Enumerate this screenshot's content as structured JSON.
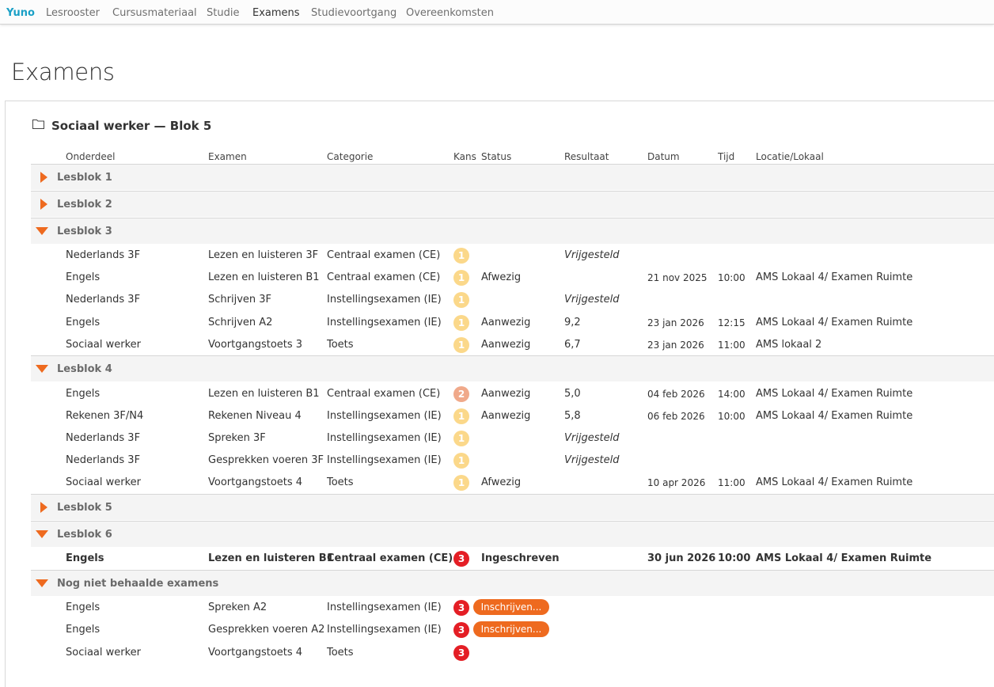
{
  "nav": {
    "brand": "Yuno",
    "items": [
      "Lesrooster",
      "Cursusmateriaal",
      "Studie",
      "Examens",
      "Studievoortgang",
      "Overeenkomsten"
    ],
    "active": "Examens"
  },
  "page": {
    "title": "Examens"
  },
  "panel": {
    "title": "Sociaal werker — Blok 5",
    "icon": "folder-icon"
  },
  "columns": {
    "onderdeel": "Onderdeel",
    "examen": "Examen",
    "categorie": "Categorie",
    "kans": "Kans",
    "status": "Status",
    "resultaat": "Resultaat",
    "datum": "Datum",
    "tijd": "Tijd",
    "locatie": "Locatie/Lokaal"
  },
  "colors": {
    "accent": "#ee6a1f",
    "brand": "#1aa0c6",
    "kans1": "#fbd88a",
    "kans2": "#f0a98a",
    "kans3": "#e41e25"
  },
  "groups": [
    {
      "label": "Lesblok 1",
      "expanded": false
    },
    {
      "label": "Lesblok 2",
      "expanded": false
    },
    {
      "label": "Lesblok 3",
      "expanded": true
    },
    {
      "label": "Lesblok 4",
      "expanded": true
    },
    {
      "label": "Lesblok 5",
      "expanded": false
    },
    {
      "label": "Lesblok 6",
      "expanded": true
    },
    {
      "label": "Nog niet behaalde examens",
      "expanded": true
    }
  ],
  "lesblok3": [
    {
      "onderdeel": "Nederlands 3F",
      "examen": "Lezen en luisteren 3F",
      "categorie": "Centraal examen (CE)",
      "kans": "1",
      "status": "",
      "resultaat": "Vrijgesteld",
      "datum": "",
      "tijd": "",
      "locatie": ""
    },
    {
      "onderdeel": "Engels",
      "examen": "Lezen en luisteren B1",
      "categorie": "Centraal examen (CE)",
      "kans": "1",
      "status": "Afwezig",
      "resultaat": "",
      "datum": "21 nov 2025",
      "tijd": "10:00",
      "locatie": "AMS Lokaal 4/ Examen Ruimte"
    },
    {
      "onderdeel": "Nederlands 3F",
      "examen": "Schrijven 3F",
      "categorie": "Instellingsexamen (IE)",
      "kans": "1",
      "status": "",
      "resultaat": "Vrijgesteld",
      "datum": "",
      "tijd": "",
      "locatie": ""
    },
    {
      "onderdeel": "Engels",
      "examen": "Schrijven A2",
      "categorie": "Instellingsexamen (IE)",
      "kans": "1",
      "status": "Aanwezig",
      "resultaat": "9,2",
      "datum": "23 jan 2026",
      "tijd": "12:15",
      "locatie": "AMS Lokaal 4/ Examen Ruimte"
    },
    {
      "onderdeel": "Sociaal werker",
      "examen": "Voortgangstoets 3",
      "categorie": "Toets",
      "kans": "1",
      "status": "Aanwezig",
      "resultaat": "6,7",
      "datum": "23 jan 2026",
      "tijd": "11:00",
      "locatie": "AMS lokaal 2"
    }
  ],
  "lesblok4": [
    {
      "onderdeel": "Engels",
      "examen": "Lezen en luisteren B1",
      "categorie": "Centraal examen (CE)",
      "kans": "2",
      "status": "Aanwezig",
      "resultaat": "5,0",
      "datum": "04 feb 2026",
      "tijd": "14:00",
      "locatie": "AMS Lokaal 4/ Examen Ruimte"
    },
    {
      "onderdeel": "Rekenen 3F/N4",
      "examen": "Rekenen Niveau 4",
      "categorie": "Instellingsexamen (IE)",
      "kans": "1",
      "status": "Aanwezig",
      "resultaat": "5,8",
      "datum": "06 feb 2026",
      "tijd": "10:00",
      "locatie": "AMS Lokaal 4/ Examen Ruimte"
    },
    {
      "onderdeel": "Nederlands 3F",
      "examen": "Spreken 3F",
      "categorie": "Instellingsexamen (IE)",
      "kans": "1",
      "status": "",
      "resultaat": "Vrijgesteld",
      "datum": "",
      "tijd": "",
      "locatie": ""
    },
    {
      "onderdeel": "Nederlands 3F",
      "examen": "Gesprekken voeren 3F",
      "categorie": "Instellingsexamen (IE)",
      "kans": "1",
      "status": "",
      "resultaat": "Vrijgesteld",
      "datum": "",
      "tijd": "",
      "locatie": ""
    },
    {
      "onderdeel": "Sociaal werker",
      "examen": "Voortgangstoets 4",
      "categorie": "Toets",
      "kans": "1",
      "status": "Afwezig",
      "resultaat": "",
      "datum": "10 apr 2026",
      "tijd": "11:00",
      "locatie": "AMS Lokaal 4/ Examen Ruimte"
    }
  ],
  "lesblok6": [
    {
      "onderdeel": "Engels",
      "examen": "Lezen en luisteren B1",
      "categorie": "Centraal examen (CE)",
      "kans": "3",
      "status": "Ingeschreven",
      "resultaat": "",
      "datum": "30 jun 2026",
      "tijd": "10:00",
      "locatie": "AMS Lokaal 4/ Examen Ruimte"
    }
  ],
  "notyet": [
    {
      "onderdeel": "Engels",
      "examen": "Spreken A2",
      "categorie": "Instellingsexamen (IE)",
      "kans": "3",
      "action": "Inschrijven..."
    },
    {
      "onderdeel": "Engels",
      "examen": "Gesprekken voeren A2",
      "categorie": "Instellingsexamen (IE)",
      "kans": "3",
      "action": "Inschrijven..."
    },
    {
      "onderdeel": "Sociaal werker",
      "examen": "Voortgangstoets 4",
      "categorie": "Toets",
      "kans": "3",
      "action": ""
    }
  ]
}
